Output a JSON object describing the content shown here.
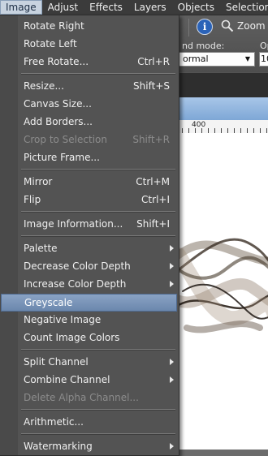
{
  "menubar": {
    "items": [
      {
        "label": "Image",
        "active": true
      },
      {
        "label": "Adjust"
      },
      {
        "label": "Effects"
      },
      {
        "label": "Layers"
      },
      {
        "label": "Objects"
      },
      {
        "label": "Selections"
      }
    ]
  },
  "toolbar": {
    "info_glyph": "i",
    "zoom_label": "Zoom",
    "blend_mode_label": "nd mode:",
    "blend_mode_value": "ormal",
    "opacity_label": "Op",
    "opacity_value": "10"
  },
  "ruler": {
    "label": "400"
  },
  "menu": {
    "items": [
      {
        "label": "Rotate Right"
      },
      {
        "label": "Rotate Left"
      },
      {
        "label": "Free Rotate...",
        "shortcut": "Ctrl+R"
      },
      {
        "separator": true
      },
      {
        "label": "Resize...",
        "shortcut": "Shift+S"
      },
      {
        "label": "Canvas Size..."
      },
      {
        "label": "Add Borders..."
      },
      {
        "label": "Crop to Selection",
        "shortcut": "Shift+R",
        "disabled": true
      },
      {
        "label": "Picture Frame..."
      },
      {
        "separator": true
      },
      {
        "label": "Mirror",
        "shortcut": "Ctrl+M"
      },
      {
        "label": "Flip",
        "shortcut": "Ctrl+I"
      },
      {
        "separator": true
      },
      {
        "label": "Image Information...",
        "shortcut": "Shift+I"
      },
      {
        "separator": true
      },
      {
        "label": "Palette",
        "submenu": true
      },
      {
        "label": "Decrease Color Depth",
        "submenu": true
      },
      {
        "label": "Increase Color Depth",
        "submenu": true
      },
      {
        "label": "Greyscale",
        "highlighted": true
      },
      {
        "label": "Negative Image"
      },
      {
        "label": "Count Image Colors"
      },
      {
        "separator": true
      },
      {
        "label": "Split Channel",
        "submenu": true
      },
      {
        "label": "Combine Channel",
        "submenu": true
      },
      {
        "label": "Delete Alpha Channel...",
        "disabled": true
      },
      {
        "separator": true
      },
      {
        "label": "Arithmetic..."
      },
      {
        "separator": true
      },
      {
        "label": "Watermarking",
        "submenu": true
      }
    ]
  }
}
